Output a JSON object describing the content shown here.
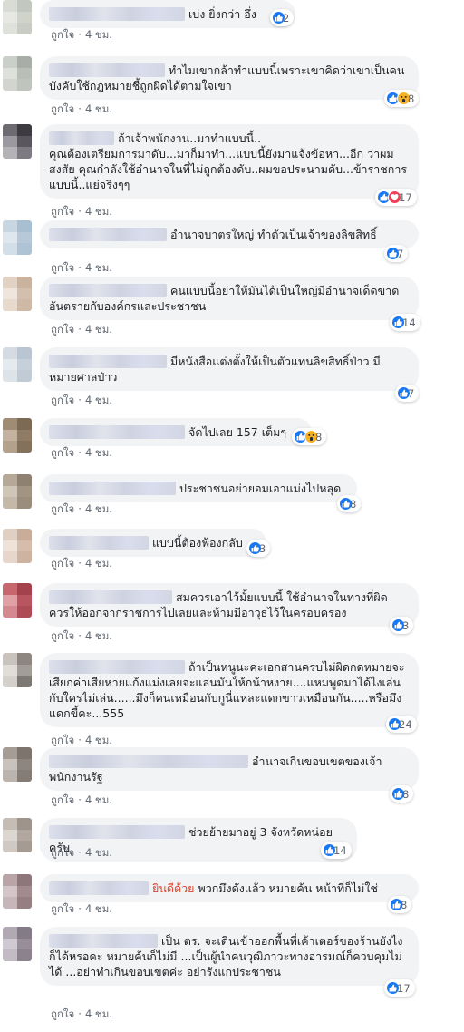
{
  "meta": {
    "like_label": "ถูกใจ",
    "separator": "·"
  },
  "comments": [
    {
      "praise": "",
      "text": "เบ่ง ยิ่งกว่า อึ่ง",
      "time": "4 ชม.",
      "count": "2",
      "reactions": [
        "like"
      ]
    },
    {
      "praise": "",
      "text": "ทำไมเขากล้าทำแบบนี้เพราะเขาคิดว่าเขาเป็นคนบังคับใช้กฎหมายชี้ถูกผิดได้ตามใจเขา",
      "time": "4 ชม.",
      "count": "8",
      "reactions": [
        "like",
        "wow"
      ]
    },
    {
      "praise": "",
      "text": "ถ้าเจ้าพนักงาน..มาทำแบบนี้..\nคุณต้องเตรียมการมาดับ...มาก็มาทำ...แบบนี้ยังมาแจ้งข้อหา...อีก ว่าผมสงสัย คุณกำลังใช้อำนาจในที่ไม่ถูกต้องดับ..ผมขอประนามดับ...ข้าราชการแบบนี้..แย่จริงๆๆ",
      "time": "4 ชม.",
      "count": "17",
      "reactions": [
        "like",
        "love"
      ]
    },
    {
      "praise": "",
      "text": "อำนาจบาตรใหญ่ ทำตัวเป็นเจ้าของลิขสิทธิ์",
      "time": "4 ชม.",
      "count": "7",
      "reactions": [
        "like"
      ]
    },
    {
      "praise": "",
      "text": "คนแบบนี้อย่าให้มันได้เป็นใหญ่มีอำนาจเด็ดขาดอันตรายกับองค์กรและประชาชน",
      "time": "4 ชม.",
      "count": "14",
      "reactions": [
        "like"
      ]
    },
    {
      "praise": "",
      "text": "มีหนังสือแต่งตั้งให้เป็นตัวแทนลิขสิทธิ์ป่าว มีหมายศาลป่าว",
      "time": "4 ชม.",
      "count": "7",
      "reactions": [
        "like"
      ]
    },
    {
      "praise": "",
      "text": "จัดไปเลย 157 เต็มๆ",
      "time": "4 ชม.",
      "count": "8",
      "reactions": [
        "like",
        "wow"
      ]
    },
    {
      "praise": "",
      "text": "ประชาชนอย่ายอมเอาแม่งไปหลุด",
      "time": "4 ชม.",
      "count": "8",
      "reactions": [
        "like"
      ]
    },
    {
      "praise": "",
      "text": "แบบนี้ต้องฟ้องกลับ",
      "time": "4 ชม.",
      "count": "3",
      "reactions": [
        "like"
      ]
    },
    {
      "praise": "",
      "text": "สมควรเอาไว้มั้ยแบบนี้ ใช้อำนาจในทางที่ผิด ควรให้ออกจากราชการไปเลยและห้ามมีอาวุธไว้ในครอบครอง",
      "time": "4 ชม.",
      "count": "3",
      "reactions": [
        "like"
      ]
    },
    {
      "praise": "",
      "text": "ถ้าเป็นหนูนะคะเอกสานครบไม่ผิดกดหมายจะเสียกค่าเสียหายแก้งแม่งเลยจะแล่นมันให้กน้าหงาย....แหมพูดมาได้ไงเล่นกับใครไม่เล่น......มึงก็คนเหมือนกับกูนี่แหละแดกขาวเหมือนกัน.....หรือมึงแดกขี้คะ...555",
      "time": "4 ชม.",
      "count": "24",
      "reactions": [
        "like"
      ]
    },
    {
      "praise": "",
      "text": "อำนาจเกินขอบเขตของเจ้าพนักงานรัฐ",
      "time": "4 ชม.",
      "count": "8",
      "reactions": [
        "like"
      ]
    },
    {
      "praise": "",
      "text": "ช่วยย้ายมาอยู่ 3 จังหวัดหน่อยครับ",
      "time": "4 ชม.",
      "count": "14",
      "reactions": [
        "like"
      ]
    },
    {
      "praise": "ยินดีด้วย",
      "text": "พวกมึงดังแล้ว หมายค้น หน้าที่ก็ไม่ใช่",
      "time": "4 ชม.",
      "count": "8",
      "reactions": [
        "like"
      ]
    },
    {
      "praise": "",
      "text": "เป็น ตร. จะเดินเข้าออกพื้นที่เค้าเตอร์ของร้านยังไงก็ได้หรอคะ หมายค้นก็ไม่มี ...เป็นผู้นำคนวุฒิภาวะทางอารมณ์ก็ควบคุมไม่ได้ ...อย่าทำเกินขอบเขตค่ะ อย่ารังแกประชาชน",
      "time": "4 ชม.",
      "count": "17",
      "reactions": [
        "like"
      ]
    }
  ]
}
